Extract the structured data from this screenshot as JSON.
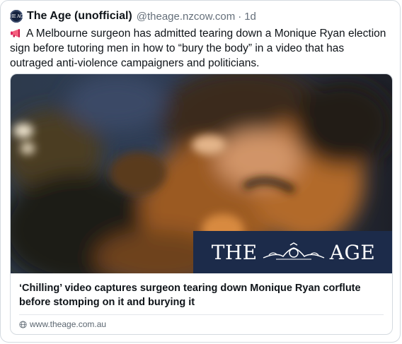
{
  "post": {
    "display_name": "The Age (unofficial)",
    "handle": "@theage.nzcow.com",
    "separator": "·",
    "timestamp": "1d",
    "avatar_text": "THE AGE",
    "body_icon": "megaphone-icon",
    "body_text": "A Melbourne surgeon has admitted tearing down a Monique Ryan election sign before tutoring men in how to “bury the body” in a video that has outraged anti-violence campaigners and politicians."
  },
  "link_card": {
    "masthead_left": "THE",
    "masthead_right": "AGE",
    "title": "‘Chilling’ video captures surgeon tearing down Monique Ryan corflute before stomping on it and burying it",
    "domain_icon": "globe-icon",
    "domain": "www.theage.com.au"
  },
  "colors": {
    "text": "#0f1419",
    "muted": "#66707b",
    "border": "#d4dae0",
    "masthead_bg": "#1c2b4a"
  }
}
